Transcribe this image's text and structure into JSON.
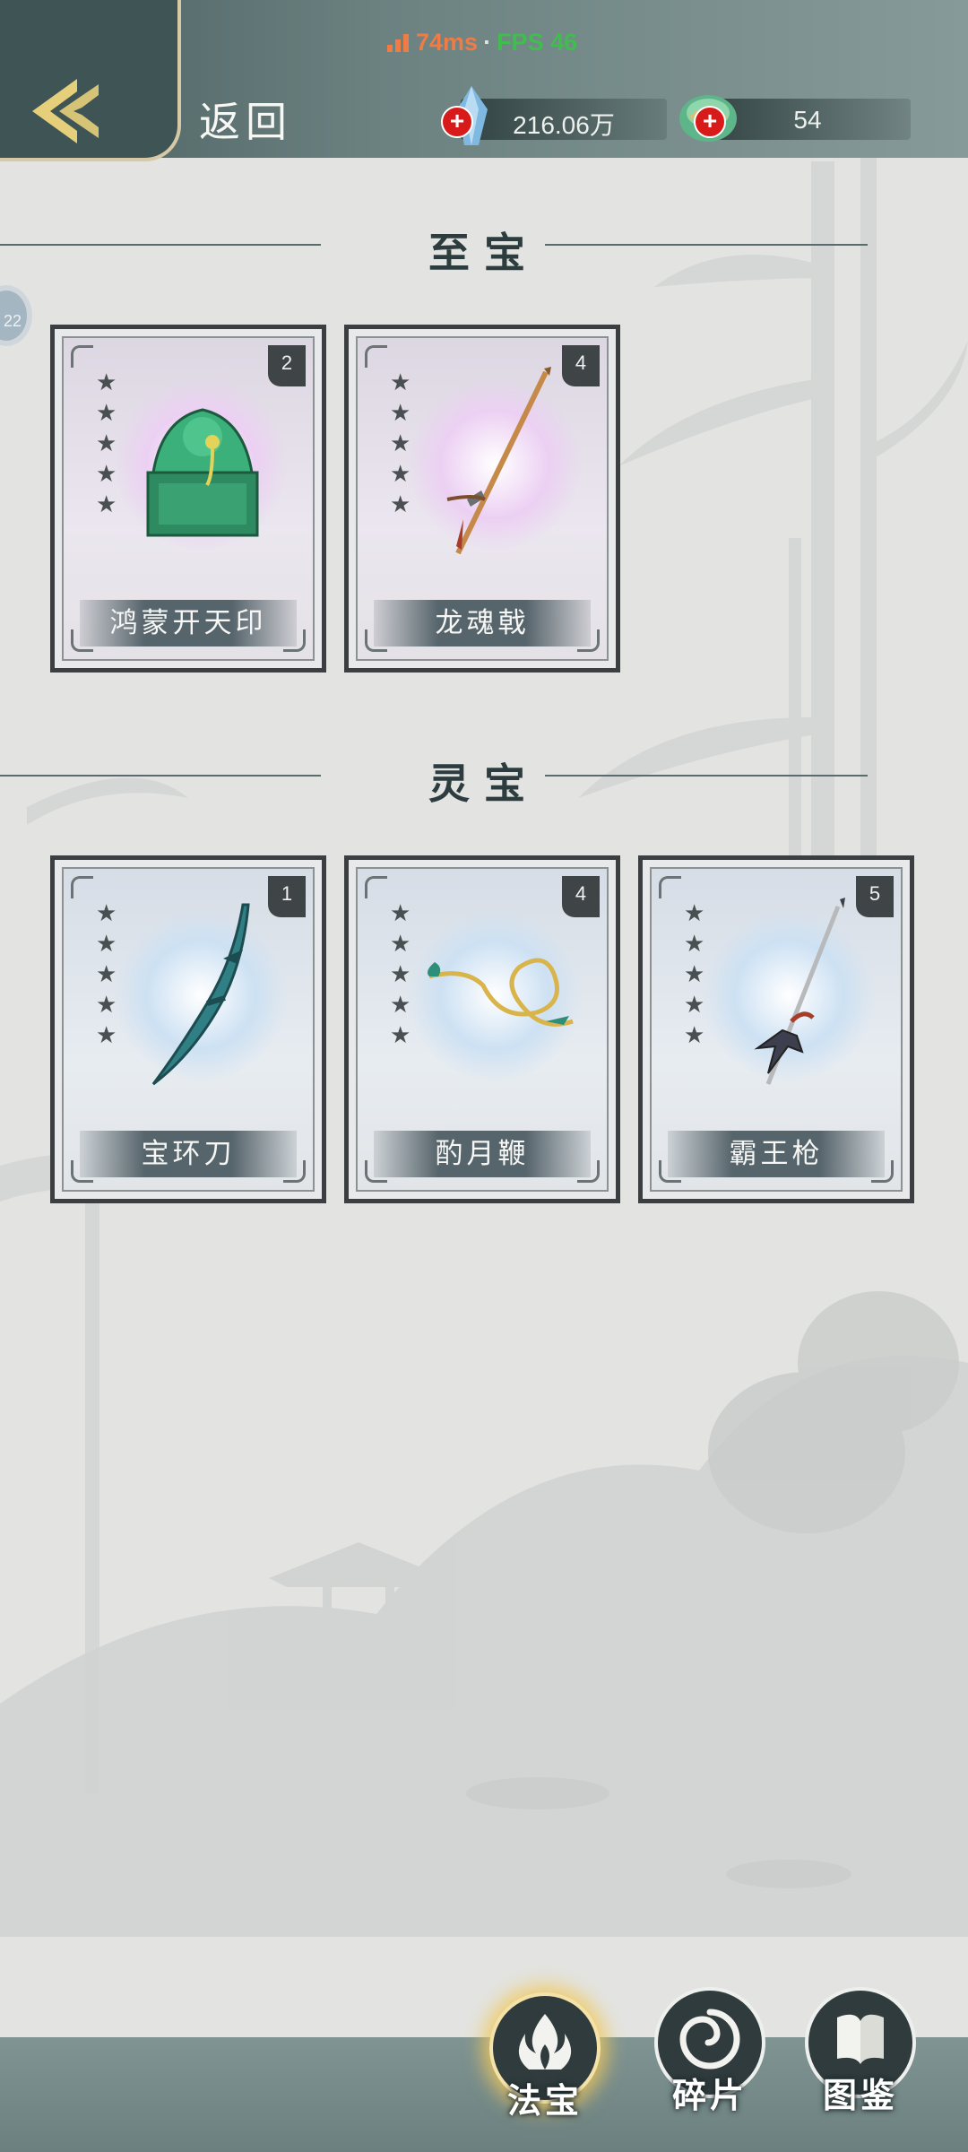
{
  "status": {
    "latency": "74ms",
    "separator": "·",
    "fps": "FPS 46"
  },
  "header": {
    "back_label": "返回"
  },
  "resources": [
    {
      "icon": "crystal-icon",
      "value": "216.06万"
    },
    {
      "icon": "jade-icon",
      "value": "54"
    }
  ],
  "side_badge": {
    "text": "22"
  },
  "sections": [
    {
      "title": "至宝",
      "cards": [
        {
          "name": "鸿蒙开天印",
          "count": "2",
          "stars": 5,
          "theme": "purple",
          "icon": "jade-seal-icon"
        },
        {
          "name": "龙魂戟",
          "count": "4",
          "stars": 5,
          "theme": "purple",
          "icon": "halberd-icon"
        }
      ]
    },
    {
      "title": "灵宝",
      "cards": [
        {
          "name": "宝环刀",
          "count": "1",
          "stars": 5,
          "theme": "blue",
          "icon": "sword-icon"
        },
        {
          "name": "酌月鞭",
          "count": "4",
          "stars": 5,
          "theme": "blue",
          "icon": "whip-icon"
        },
        {
          "name": "霸王枪",
          "count": "5",
          "stars": 5,
          "theme": "blue",
          "icon": "spear-icon"
        }
      ]
    }
  ],
  "nav": [
    {
      "label": "法宝",
      "icon": "flame-icon",
      "active": true
    },
    {
      "label": "碎片",
      "icon": "swirl-icon",
      "active": false
    },
    {
      "label": "图鉴",
      "icon": "book-icon",
      "active": false
    }
  ],
  "colors": {
    "accent_gold": "#f0c85a",
    "header": "#4b5e5f",
    "card_frame": "#3b3f41"
  }
}
